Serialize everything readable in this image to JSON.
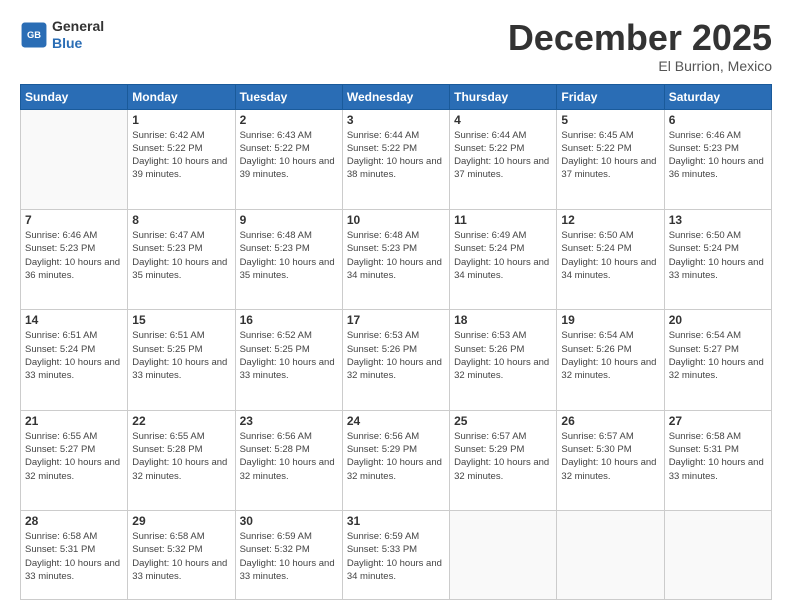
{
  "header": {
    "logo": {
      "general": "General",
      "blue": "Blue"
    },
    "title": "December 2025",
    "location": "El Burrion, Mexico"
  },
  "calendar": {
    "days_of_week": [
      "Sunday",
      "Monday",
      "Tuesday",
      "Wednesday",
      "Thursday",
      "Friday",
      "Saturday"
    ],
    "weeks": [
      [
        {
          "day": "",
          "sunrise": "",
          "sunset": "",
          "daylight": ""
        },
        {
          "day": "1",
          "sunrise": "Sunrise: 6:42 AM",
          "sunset": "Sunset: 5:22 PM",
          "daylight": "Daylight: 10 hours and 39 minutes."
        },
        {
          "day": "2",
          "sunrise": "Sunrise: 6:43 AM",
          "sunset": "Sunset: 5:22 PM",
          "daylight": "Daylight: 10 hours and 39 minutes."
        },
        {
          "day": "3",
          "sunrise": "Sunrise: 6:44 AM",
          "sunset": "Sunset: 5:22 PM",
          "daylight": "Daylight: 10 hours and 38 minutes."
        },
        {
          "day": "4",
          "sunrise": "Sunrise: 6:44 AM",
          "sunset": "Sunset: 5:22 PM",
          "daylight": "Daylight: 10 hours and 37 minutes."
        },
        {
          "day": "5",
          "sunrise": "Sunrise: 6:45 AM",
          "sunset": "Sunset: 5:22 PM",
          "daylight": "Daylight: 10 hours and 37 minutes."
        },
        {
          "day": "6",
          "sunrise": "Sunrise: 6:46 AM",
          "sunset": "Sunset: 5:23 PM",
          "daylight": "Daylight: 10 hours and 36 minutes."
        }
      ],
      [
        {
          "day": "7",
          "sunrise": "Sunrise: 6:46 AM",
          "sunset": "Sunset: 5:23 PM",
          "daylight": "Daylight: 10 hours and 36 minutes."
        },
        {
          "day": "8",
          "sunrise": "Sunrise: 6:47 AM",
          "sunset": "Sunset: 5:23 PM",
          "daylight": "Daylight: 10 hours and 35 minutes."
        },
        {
          "day": "9",
          "sunrise": "Sunrise: 6:48 AM",
          "sunset": "Sunset: 5:23 PM",
          "daylight": "Daylight: 10 hours and 35 minutes."
        },
        {
          "day": "10",
          "sunrise": "Sunrise: 6:48 AM",
          "sunset": "Sunset: 5:23 PM",
          "daylight": "Daylight: 10 hours and 34 minutes."
        },
        {
          "day": "11",
          "sunrise": "Sunrise: 6:49 AM",
          "sunset": "Sunset: 5:24 PM",
          "daylight": "Daylight: 10 hours and 34 minutes."
        },
        {
          "day": "12",
          "sunrise": "Sunrise: 6:50 AM",
          "sunset": "Sunset: 5:24 PM",
          "daylight": "Daylight: 10 hours and 34 minutes."
        },
        {
          "day": "13",
          "sunrise": "Sunrise: 6:50 AM",
          "sunset": "Sunset: 5:24 PM",
          "daylight": "Daylight: 10 hours and 33 minutes."
        }
      ],
      [
        {
          "day": "14",
          "sunrise": "Sunrise: 6:51 AM",
          "sunset": "Sunset: 5:24 PM",
          "daylight": "Daylight: 10 hours and 33 minutes."
        },
        {
          "day": "15",
          "sunrise": "Sunrise: 6:51 AM",
          "sunset": "Sunset: 5:25 PM",
          "daylight": "Daylight: 10 hours and 33 minutes."
        },
        {
          "day": "16",
          "sunrise": "Sunrise: 6:52 AM",
          "sunset": "Sunset: 5:25 PM",
          "daylight": "Daylight: 10 hours and 33 minutes."
        },
        {
          "day": "17",
          "sunrise": "Sunrise: 6:53 AM",
          "sunset": "Sunset: 5:26 PM",
          "daylight": "Daylight: 10 hours and 32 minutes."
        },
        {
          "day": "18",
          "sunrise": "Sunrise: 6:53 AM",
          "sunset": "Sunset: 5:26 PM",
          "daylight": "Daylight: 10 hours and 32 minutes."
        },
        {
          "day": "19",
          "sunrise": "Sunrise: 6:54 AM",
          "sunset": "Sunset: 5:26 PM",
          "daylight": "Daylight: 10 hours and 32 minutes."
        },
        {
          "day": "20",
          "sunrise": "Sunrise: 6:54 AM",
          "sunset": "Sunset: 5:27 PM",
          "daylight": "Daylight: 10 hours and 32 minutes."
        }
      ],
      [
        {
          "day": "21",
          "sunrise": "Sunrise: 6:55 AM",
          "sunset": "Sunset: 5:27 PM",
          "daylight": "Daylight: 10 hours and 32 minutes."
        },
        {
          "day": "22",
          "sunrise": "Sunrise: 6:55 AM",
          "sunset": "Sunset: 5:28 PM",
          "daylight": "Daylight: 10 hours and 32 minutes."
        },
        {
          "day": "23",
          "sunrise": "Sunrise: 6:56 AM",
          "sunset": "Sunset: 5:28 PM",
          "daylight": "Daylight: 10 hours and 32 minutes."
        },
        {
          "day": "24",
          "sunrise": "Sunrise: 6:56 AM",
          "sunset": "Sunset: 5:29 PM",
          "daylight": "Daylight: 10 hours and 32 minutes."
        },
        {
          "day": "25",
          "sunrise": "Sunrise: 6:57 AM",
          "sunset": "Sunset: 5:29 PM",
          "daylight": "Daylight: 10 hours and 32 minutes."
        },
        {
          "day": "26",
          "sunrise": "Sunrise: 6:57 AM",
          "sunset": "Sunset: 5:30 PM",
          "daylight": "Daylight: 10 hours and 32 minutes."
        },
        {
          "day": "27",
          "sunrise": "Sunrise: 6:58 AM",
          "sunset": "Sunset: 5:31 PM",
          "daylight": "Daylight: 10 hours and 33 minutes."
        }
      ],
      [
        {
          "day": "28",
          "sunrise": "Sunrise: 6:58 AM",
          "sunset": "Sunset: 5:31 PM",
          "daylight": "Daylight: 10 hours and 33 minutes."
        },
        {
          "day": "29",
          "sunrise": "Sunrise: 6:58 AM",
          "sunset": "Sunset: 5:32 PM",
          "daylight": "Daylight: 10 hours and 33 minutes."
        },
        {
          "day": "30",
          "sunrise": "Sunrise: 6:59 AM",
          "sunset": "Sunset: 5:32 PM",
          "daylight": "Daylight: 10 hours and 33 minutes."
        },
        {
          "day": "31",
          "sunrise": "Sunrise: 6:59 AM",
          "sunset": "Sunset: 5:33 PM",
          "daylight": "Daylight: 10 hours and 34 minutes."
        },
        {
          "day": "",
          "sunrise": "",
          "sunset": "",
          "daylight": ""
        },
        {
          "day": "",
          "sunrise": "",
          "sunset": "",
          "daylight": ""
        },
        {
          "day": "",
          "sunrise": "",
          "sunset": "",
          "daylight": ""
        }
      ]
    ]
  }
}
